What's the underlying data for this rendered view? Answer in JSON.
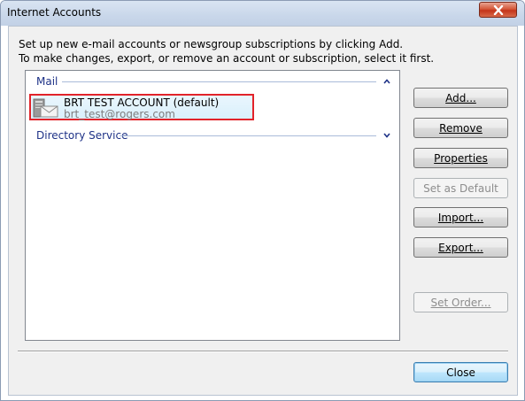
{
  "window": {
    "title": "Internet Accounts"
  },
  "instructions": {
    "line1": "Set up new e-mail accounts or newsgroup subscriptions by clicking Add.",
    "line2": "To make changes, export, or remove an account or subscription, select it first."
  },
  "list": {
    "mail_group": "Mail",
    "directory_group": "Directory Service",
    "account": {
      "name": "BRT TEST ACCOUNT (default)",
      "email": "brt_test@rogers.com"
    }
  },
  "buttons": {
    "add": "Add...",
    "remove": "Remove",
    "properties": "Properties",
    "set_default": "Set as Default",
    "import": "Import...",
    "export": "Export...",
    "set_order": "Set Order...",
    "close": "Close"
  },
  "colors": {
    "highlight_border": "#e2232a",
    "group_header_text": "#1e3287",
    "titlebar_close": "#c4341a"
  },
  "icons": {
    "close_window": "close-icon",
    "mail_collapse": "chevron-up-icon",
    "directory_expand": "chevron-down-icon",
    "account": "mail-account-icon"
  }
}
